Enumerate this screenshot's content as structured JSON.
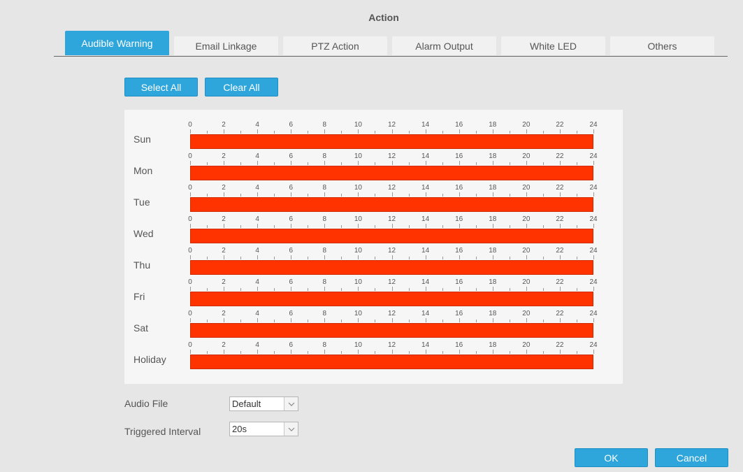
{
  "dialog": {
    "title": "Action"
  },
  "tabs": [
    {
      "label": "Audible Warning",
      "active": true
    },
    {
      "label": "Email Linkage",
      "active": false
    },
    {
      "label": "PTZ Action",
      "active": false
    },
    {
      "label": "Alarm Output",
      "active": false
    },
    {
      "label": "White LED",
      "active": false
    },
    {
      "label": "Others",
      "active": false
    }
  ],
  "toolbar": {
    "select_all_label": "Select All",
    "clear_all_label": "Clear All"
  },
  "schedule": {
    "hour_labels": [
      "0",
      "2",
      "4",
      "6",
      "8",
      "10",
      "12",
      "14",
      "16",
      "18",
      "20",
      "22",
      "24"
    ],
    "bar_color": "#ff3300",
    "days": [
      {
        "label": "Sun",
        "ranges": [
          [
            0,
            24
          ]
        ]
      },
      {
        "label": "Mon",
        "ranges": [
          [
            0,
            24
          ]
        ]
      },
      {
        "label": "Tue",
        "ranges": [
          [
            0,
            24
          ]
        ]
      },
      {
        "label": "Wed",
        "ranges": [
          [
            0,
            24
          ]
        ]
      },
      {
        "label": "Thu",
        "ranges": [
          [
            0,
            24
          ]
        ]
      },
      {
        "label": "Fri",
        "ranges": [
          [
            0,
            24
          ]
        ]
      },
      {
        "label": "Sat",
        "ranges": [
          [
            0,
            24
          ]
        ]
      },
      {
        "label": "Holiday",
        "ranges": [
          [
            0,
            24
          ]
        ]
      }
    ]
  },
  "audio_file": {
    "label": "Audio File",
    "value": "Default"
  },
  "triggered_interval": {
    "label": "Triggered Interval",
    "value": "20s"
  },
  "footer": {
    "ok_label": "OK",
    "cancel_label": "Cancel"
  },
  "colors": {
    "accent": "#2ea6dc",
    "background": "#e6e6e6",
    "panel": "#f6f6f6"
  },
  "icons": {
    "dropdown": "chevron-down-icon"
  }
}
